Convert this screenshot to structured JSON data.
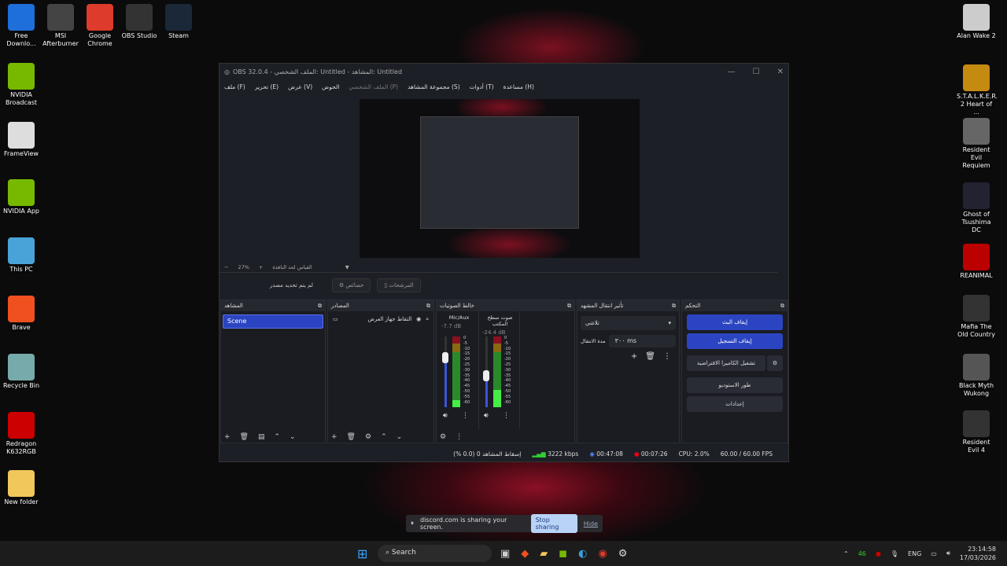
{
  "desktop": {
    "left_icons": [
      {
        "label": "Free Downlo...",
        "color": "#1e6fd9"
      },
      {
        "label": "MSI Afterburner",
        "color": "#444"
      },
      {
        "label": "Google Chrome",
        "color": "#dd3b2b"
      },
      {
        "label": "OBS Studio",
        "color": "#333"
      },
      {
        "label": "Steam",
        "color": "#1b2838"
      },
      {
        "label": "NVIDIA Broadcast",
        "color": "#76b900"
      },
      {
        "label": "FrameView",
        "color": "#ddd"
      },
      {
        "label": "NVIDIA App",
        "color": "#76b900"
      },
      {
        "label": "This PC",
        "color": "#4aa3d8"
      },
      {
        "label": "Brave",
        "color": "#f05020"
      },
      {
        "label": "Recycle Bin",
        "color": "#7aa"
      },
      {
        "label": "Redragon K632RGB",
        "color": "#c00"
      },
      {
        "label": "New folder",
        "color": "#f1c65a"
      }
    ],
    "right_icons": [
      {
        "label": "Alan Wake 2",
        "color": "#ccc"
      },
      {
        "label": "S.T.A.L.K.E.R. 2 Heart of ...",
        "color": "#c58a10"
      },
      {
        "label": "Resident Evil Requiem",
        "color": "#666"
      },
      {
        "label": "Ghost of Tsushima DC",
        "color": "#223"
      },
      {
        "label": "REANIMAL",
        "color": "#b00"
      },
      {
        "label": "Mafia The Old Country",
        "color": "#333"
      },
      {
        "label": "Black Myth Wukong",
        "color": "#555"
      },
      {
        "label": "Resident Evil 4",
        "color": "#333"
      }
    ]
  },
  "obs": {
    "title": "OBS 32.0.4 - الملف الشخصي: Untitled - المشاهد: Untitled",
    "menu": [
      "ملف (F)",
      "تحرير (E)",
      "عرض (V)",
      "الحوض",
      "الملف الشخصي (P)",
      "مجموعة المشاهد (S)",
      "أدوات (T)",
      "مساعدة (H)"
    ],
    "zoom": "27%",
    "zoom_mode": "القياس لحد النافذة",
    "no_source": "لم يتم تحديد مصدر",
    "properties": "خصائص",
    "filters": "المرشحات",
    "docks": {
      "scenes": "المشاهد",
      "sources": "المصادر",
      "mixer": "خالط الصوتيات",
      "transitions": "تأثير انتقال المشهد",
      "controls": "التحكم"
    },
    "scenes": [
      "Scene"
    ],
    "sources": [
      "التقاط جهاز العرض"
    ],
    "mixer": [
      {
        "name": "Mic/Aux",
        "db": "-7.7 dB",
        "level": 0.1,
        "fader": 0.7
      },
      {
        "name": "صوت سطح المكتب",
        "db": "-24.4 dB",
        "level": 0.25,
        "fader": 0.45
      }
    ],
    "meter_ticks": [
      "0",
      "-5",
      "-10",
      "-15",
      "-20",
      "-25",
      "-30",
      "-35",
      "-40",
      "-45",
      "-50",
      "-55",
      "-60"
    ],
    "transition": "تلاشي",
    "duration_label": "مدة الانتقال",
    "duration": "٣٠٠ ms",
    "controls": [
      "إيقاف البث",
      "إيقاف التسجيل",
      "تشغيل الكاميرا الافتراضية",
      "طور الاستوديو",
      "إعدادات"
    ],
    "status": {
      "dropped": "إسقاط المشاهد 0 (0.0 %)",
      "bitrate": "3222 kbps",
      "stream_time": "00:47:08",
      "rec_time": "00:07:26",
      "cpu": "CPU: 2.0%",
      "fps": "60.00 / 60.00 FPS"
    }
  },
  "share": {
    "text": "discord.com is sharing your screen.",
    "stop": "Stop sharing",
    "hide": "Hide"
  },
  "taskbar": {
    "search": "Search",
    "badge": "46",
    "lang": "ENG",
    "time": "23:14:58",
    "date": "17/03/2026"
  }
}
